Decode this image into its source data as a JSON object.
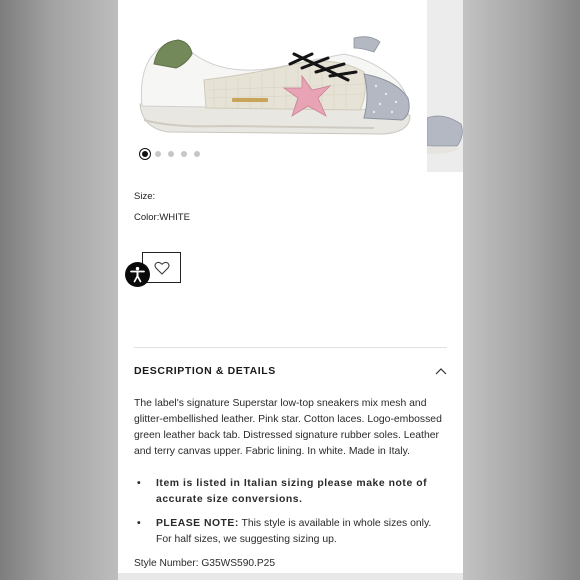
{
  "product": {
    "size_label": "Size:",
    "color_label": "Color:",
    "color_value": "WHITE",
    "gallery": {
      "dots": 5,
      "active_index": 0
    }
  },
  "details": {
    "title": "DESCRIPTION & DETAILS",
    "expanded": true,
    "description": "The label's signature Superstar low-top sneakers mix mesh and glitter-embellished leather. Pink star. Cotton laces. Logo-embossed green leather back tab. Distressed signature rubber soles. Leather and terry canvas upper. Fabric lining. In white. Made in Italy.",
    "bullet_mark": "•",
    "bullet1": "Item is listed in Italian sizing please make note of accurate size conversions.",
    "bullet2_strong": "PLEASE NOTE:",
    "bullet2_rest": " This style is available in whole sizes only. For half sizes, we suggesting sizing up.",
    "style_number": "Style Number: G35WS590.P25"
  },
  "icons": {
    "wishlist": "heart-icon",
    "accessibility": "accessibility-icon",
    "collapse": "chevron-up-icon"
  },
  "colors": {
    "star": "#e8a3b5",
    "heel_tab": "#74895a",
    "glitter": "#b3b8c2"
  }
}
